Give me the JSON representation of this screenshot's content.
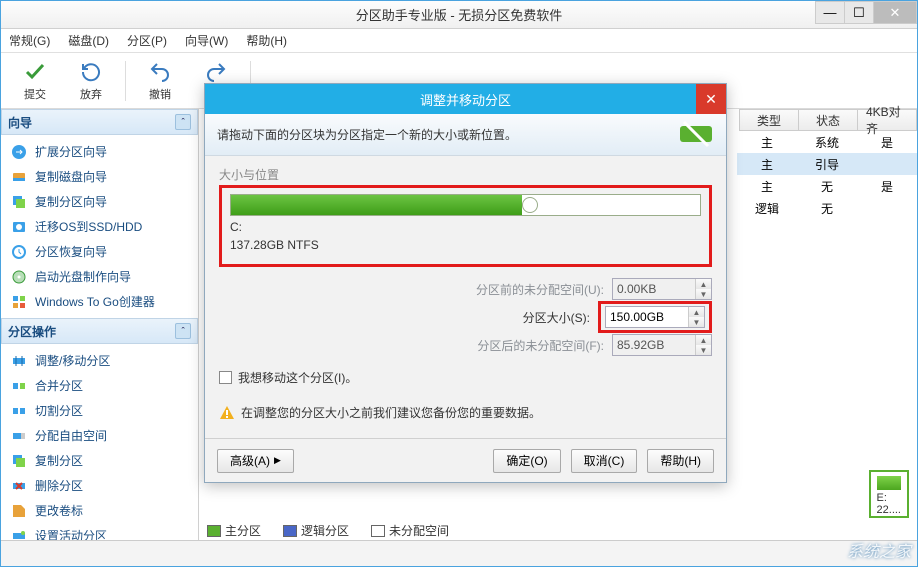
{
  "window": {
    "title": "分区助手专业版 - 无损分区免费软件"
  },
  "menu": {
    "items": [
      "常规(G)",
      "磁盘(D)",
      "分区(P)",
      "向导(W)",
      "帮助(H)"
    ]
  },
  "toolbar": {
    "items": [
      "提交",
      "放弃",
      "撤销",
      "重做"
    ]
  },
  "sidebar": {
    "wizard": {
      "title": "向导",
      "items": [
        "扩展分区向导",
        "复制磁盘向导",
        "复制分区向导",
        "迁移OS到SSD/HDD",
        "分区恢复向导",
        "启动光盘制作向导",
        "Windows To Go创建器"
      ]
    },
    "ops": {
      "title": "分区操作",
      "items": [
        "调整/移动分区",
        "合并分区",
        "切割分区",
        "分配自由空间",
        "复制分区",
        "删除分区",
        "更改卷标",
        "设置活动分区"
      ]
    }
  },
  "grid": {
    "cols": [
      "类型",
      "状态",
      "4KB对齐"
    ],
    "rows": [
      {
        "type": "主",
        "state": "系统",
        "align": "是"
      },
      {
        "type": "主",
        "state": "引导",
        "align": ""
      },
      {
        "type": "主",
        "state": "无",
        "align": "是"
      },
      {
        "type": "逻辑",
        "state": "无",
        "align": ""
      }
    ]
  },
  "disk_strip": {
    "label": "E:",
    "sub": "22...."
  },
  "legend": {
    "primary": "主分区",
    "logical": "逻辑分区",
    "unalloc": "未分配空间"
  },
  "dialog": {
    "title": "调整并移动分区",
    "instruction": "请拖动下面的分区块为分区指定一个新的大小或新位置。",
    "group": "大小与位置",
    "part_name": "C:",
    "part_info": "137.28GB NTFS",
    "row_before": "分区前的未分配空间(U):",
    "val_before": "0.00KB",
    "row_size": "分区大小(S):",
    "val_size": "150.00GB",
    "row_after": "分区后的未分配空间(F):",
    "val_after": "85.92GB",
    "checkbox": "我想移动这个分区(I)。",
    "warning": "在调整您的分区大小之前我们建议您备份您的重要数据。",
    "btn_adv": "高级(A)",
    "btn_ok": "确定(O)",
    "btn_cancel": "取消(C)",
    "btn_help": "帮助(H)"
  },
  "watermark": "系统之家"
}
